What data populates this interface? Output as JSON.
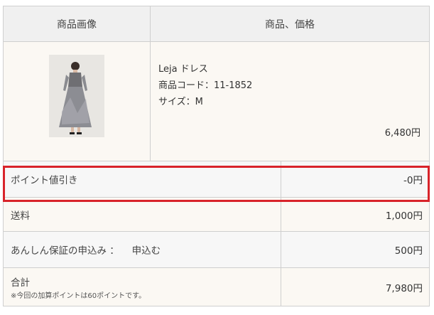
{
  "table": {
    "header": {
      "image_col": "商品画像",
      "product_col": "商品、価格"
    },
    "product": {
      "name": "Leja ドレス",
      "code": "商品コード：11-1852",
      "size": "サイズ：M",
      "price": "6,480円",
      "image_alt": "dress product photo"
    },
    "rows": [
      {
        "label": "ポイント値引き",
        "value": "-0円"
      },
      {
        "label": "送料",
        "value": "1,000円"
      },
      {
        "label": "あんしん保証の申込み ： 　申込む",
        "value": "500円"
      }
    ],
    "total": {
      "label": "合計",
      "note": "※今回の加算ポイントは60ポイントです。",
      "value": "7,980円"
    }
  },
  "colors": {
    "highlight_border": "#d8232a"
  }
}
